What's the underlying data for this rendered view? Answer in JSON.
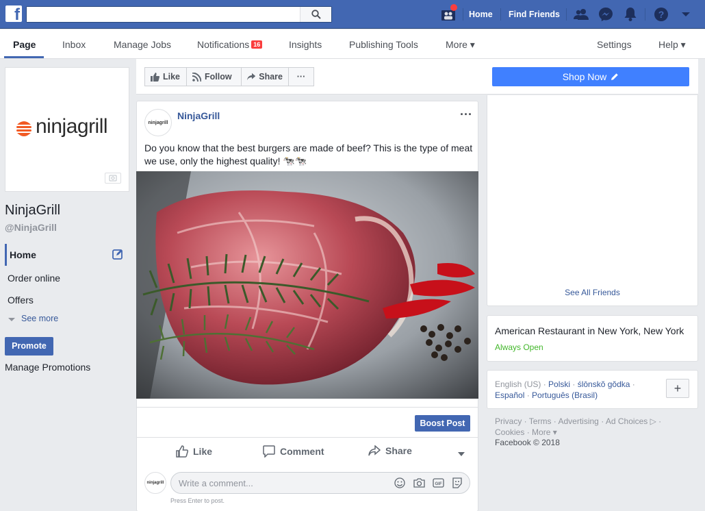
{
  "topbar": {
    "logo": "f",
    "search_placeholder": "",
    "links": [
      "Home",
      "Find Friends"
    ]
  },
  "page_nav": {
    "tabs": [
      {
        "label": "Page",
        "active": true
      },
      {
        "label": "Inbox"
      },
      {
        "label": "Manage Jobs"
      },
      {
        "label": "Notifications",
        "badge": "16"
      },
      {
        "label": "Insights"
      },
      {
        "label": "Publishing Tools"
      },
      {
        "label": "More ▾"
      }
    ],
    "right": [
      "Settings",
      "Help ▾"
    ]
  },
  "page": {
    "logo_text": "ninjagrill",
    "name": "NinjaGrill",
    "handle": "@NinjaGrill"
  },
  "sidebar": {
    "items": [
      "Home",
      "Order online",
      "Offers",
      "See more"
    ],
    "promote_label": "Promote",
    "manage_label": "Manage Promotions"
  },
  "actions": {
    "like": "Like",
    "follow": "Follow",
    "share": "Share",
    "more": "···",
    "shop_now": "Shop Now"
  },
  "post": {
    "avatar_text": "ninjagrill",
    "author": "NinjaGrill",
    "menu": "···",
    "text": "Do you know that the best burgers are made of beef? This is the type of meat we use, only the highest quality! 🐄🐄",
    "boost_label": "Boost Post",
    "reactions": [
      "Like",
      "Comment",
      "Share"
    ],
    "comment_placeholder": "Write a comment...",
    "press_enter": "Press Enter to post."
  },
  "right": {
    "see_all_friends": "See All Friends",
    "about_title": "American Restaurant in New York, New York",
    "about_status": "Always Open",
    "languages": {
      "current": "English (US)",
      "others": [
        "Polski",
        "ślōnskŏ gŏdka",
        "Español",
        "Português (Brasil)"
      ]
    },
    "plus": "+",
    "footer_links": [
      "Privacy",
      "Terms",
      "Advertising",
      "Ad Choices ▷",
      "Cookies",
      "More ▾"
    ],
    "copyright": "Facebook © 2018"
  },
  "colors": {
    "brand": "#4267b2",
    "shop": "#4080ff",
    "open": "#42b72a",
    "badge": "#fa3e3e",
    "logo_accent": "#f15a24"
  }
}
